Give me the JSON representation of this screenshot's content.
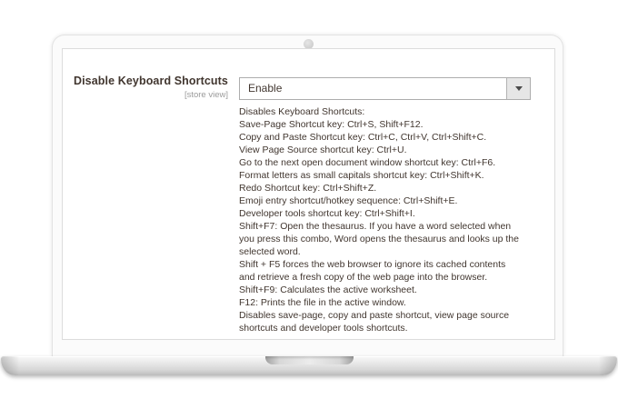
{
  "colors": {
    "label_text": "#41362f",
    "help_text": "#41362f",
    "scope_text": "#9b9b9b",
    "select_border": "#adadad",
    "select_arrow_box_bg": "#e6e6e6",
    "laptop_base_silver": "#d6d6d6"
  },
  "screen": {
    "field": {
      "label": "Disable Keyboard Shortcuts",
      "scope": "[store view]",
      "select": {
        "value": "Enable"
      },
      "help_lines": [
        "Disables Keyboard Shortcuts:",
        "Save-Page Shortcut key: Ctrl+S, Shift+F12.",
        "Copy and Paste Shortcut key: Ctrl+C, Ctrl+V, Ctrl+Shift+C.",
        "View Page Source shortcut key: Ctrl+U.",
        "Go to the next open document window shortcut key: Ctrl+F6.",
        "Format letters as small capitals shortcut key: Ctrl+Shift+K.",
        "Redo Shortcut key: Ctrl+Shift+Z.",
        "Emoji entry shortcut/hotkey sequence: Ctrl+Shift+E.",
        "Developer tools shortcut key: Ctrl+Shift+I.",
        "Shift+F7: Open the thesaurus. If you have a word selected when",
        "you press this combo, Word opens the thesaurus and looks up the",
        "selected word.",
        "Shift + F5 forces the web browser to ignore its cached contents",
        "and retrieve a fresh copy of the web page into the browser.",
        "Shift+F9: Calculates the active worksheet.",
        "F12: Prints the file in the active window.",
        "Disables save-page, copy and paste shortcut, view page source",
        "shortcuts and developer tools shortcuts."
      ]
    }
  }
}
